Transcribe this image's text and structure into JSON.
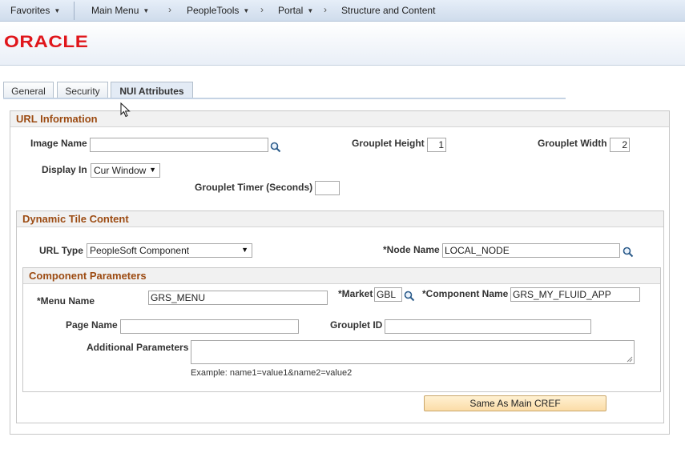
{
  "nav": {
    "favorites": "Favorites",
    "main_menu": "Main Menu",
    "peopletools": "PeopleTools",
    "portal": "Portal",
    "current": "Structure and Content",
    "arrow": "›"
  },
  "brand": {
    "logo": "ORACLE",
    "color": "#e0161b"
  },
  "tabs": [
    {
      "label": "General"
    },
    {
      "label": "Security"
    },
    {
      "label": "NUI Attributes",
      "active": true
    }
  ],
  "url_info": {
    "header": "URL Information",
    "image_name_label": "Image Name",
    "image_name_value": "",
    "grouplet_height_label": "Grouplet Height",
    "grouplet_height_value": "1",
    "grouplet_width_label": "Grouplet Width",
    "grouplet_width_value": "2",
    "display_in_label": "Display In",
    "display_in_value": "Cur Window",
    "grouplet_timer_label": "Grouplet Timer (Seconds)",
    "grouplet_timer_value": ""
  },
  "dynamic_tile": {
    "header": "Dynamic Tile Content",
    "url_type_label": "URL Type",
    "url_type_value": "PeopleSoft Component",
    "node_name_label": "*Node Name",
    "node_name_value": "LOCAL_NODE"
  },
  "component_params": {
    "header": "Component Parameters",
    "menu_name_label": "*Menu Name",
    "menu_name_value": "GRS_MENU",
    "market_label": "*Market",
    "market_value": "GBL",
    "component_name_label": "*Component Name",
    "component_name_value": "GRS_MY_FLUID_APP",
    "page_name_label": "Page Name",
    "page_name_value": "",
    "grouplet_id_label": "Grouplet ID",
    "grouplet_id_value": "",
    "additional_params_label": "Additional Parameters",
    "additional_params_value": "",
    "example_text": "Example: name1=value1&name2=value2"
  },
  "buttons": {
    "same_as_main_cref": "Same As Main CREF"
  },
  "icons": {
    "lookup": "magnifier-icon",
    "dropdown": "triangle-down",
    "cursor": "mouse-pointer"
  }
}
